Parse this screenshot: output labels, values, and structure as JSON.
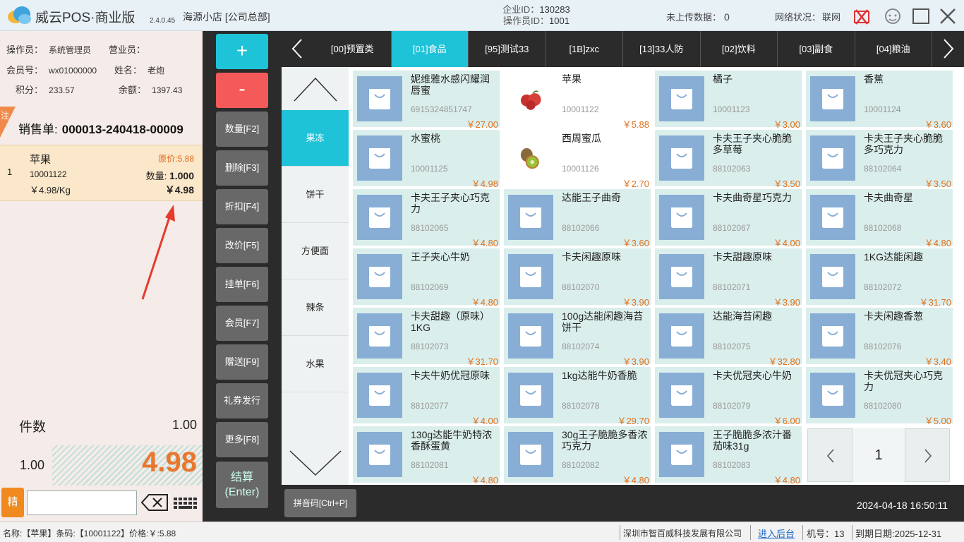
{
  "header": {
    "app_title": "威云POS·商业版",
    "version": "2.4.0.45",
    "store": "海源小店 [公司总部]",
    "enterprise_label": "企业ID：",
    "enterprise_id": "130283",
    "operator_id_label": "操作员ID：",
    "operator_id": "1001",
    "upload_label": "未上传数据：",
    "upload_count": "0",
    "network_label": "网络状况：",
    "network_status": "联网",
    "colors": {
      "accent": "#1ec3d8",
      "minus": "#f45a5a",
      "price": "#e0731e"
    }
  },
  "left": {
    "operator_label": "操作员：",
    "operator": "系统管理员",
    "sales_label": "营业员：",
    "sales": "",
    "member_label": "会员号：",
    "member": "wx01000000",
    "name_label": "姓名：",
    "name": "老炮",
    "points_label": "积分：",
    "points": "233.57",
    "balance_label": "余额：",
    "balance": "1397.43",
    "note_tag": "注",
    "order_label": "销售单:",
    "order_no": "000013-240418-00009",
    "items": [
      {
        "idx": "1",
        "name": "苹果",
        "orig_price": "原价:5.88",
        "code": "10001122",
        "qty_label": "数量:",
        "qty": "1.000",
        "unit_price": "￥4.98/Kg",
        "amount": "￥4.98"
      }
    ],
    "count_label": "件数",
    "count_value": "1.00",
    "sum_qty": "1.00",
    "sum_total": "4.98",
    "precise_label": "精",
    "search_value": ""
  },
  "functions": [
    {
      "name": "add-button",
      "label": "+"
    },
    {
      "name": "subtract-button",
      "label": "-"
    },
    {
      "name": "quantity-button",
      "label": "数量[F2]"
    },
    {
      "name": "delete-button",
      "label": "删除[F3]"
    },
    {
      "name": "discount-button",
      "label": "折扣[F4]"
    },
    {
      "name": "change-price-button",
      "label": "改价[F5]"
    },
    {
      "name": "hold-order-button",
      "label": "挂单[F6]"
    },
    {
      "name": "member-button",
      "label": "会员[F7]"
    },
    {
      "name": "gift-button",
      "label": "赠送[F9]"
    },
    {
      "name": "voucher-button",
      "label": "礼券发行"
    },
    {
      "name": "more-button",
      "label": "更多[F8]"
    }
  ],
  "checkout": {
    "line1": "结算",
    "line2": "(Enter)"
  },
  "tabs": [
    "[00]预置类",
    "[01]食品",
    "[95]测试33",
    "[1B]zxc",
    "[13]33人防",
    "[02]饮料",
    "[03]副食",
    "[04]粮油"
  ],
  "active_tab": 1,
  "subcategories": [
    "果冻",
    "饼干",
    "方便面",
    "辣条",
    "水果"
  ],
  "active_subcategory": 0,
  "products": [
    {
      "name": "妮维雅水感闪耀润唇蜜",
      "code": "6915324851747",
      "price": "￥27.00"
    },
    {
      "name": "苹果",
      "code": "10001122",
      "price": "￥5.88",
      "photo": "apple"
    },
    {
      "name": "橘子",
      "code": "10001123",
      "price": "￥3.00"
    },
    {
      "name": "香蕉",
      "code": "10001124",
      "price": "￥3.60"
    },
    {
      "name": "水蜜桃",
      "code": "10001125",
      "price": "￥4.98"
    },
    {
      "name": "西周蜜瓜",
      "code": "10001126",
      "price": "￥2.70",
      "photo": "kiwi"
    },
    {
      "name": "卡夫王子夹心脆脆多草莓",
      "code": "88102063",
      "price": "￥3.50"
    },
    {
      "name": "卡夫王子夹心脆脆多巧克力",
      "code": "88102064",
      "price": "￥3.50"
    },
    {
      "name": "卡夫王子夹心巧克力",
      "code": "88102065",
      "price": "￥4.80"
    },
    {
      "name": "达能王子曲奇",
      "code": "88102066",
      "price": "￥3.60"
    },
    {
      "name": "卡夫曲奇星巧克力",
      "code": "88102067",
      "price": "￥4.00"
    },
    {
      "name": "卡夫曲奇星",
      "code": "88102068",
      "price": "￥4.80"
    },
    {
      "name": "王子夹心牛奶",
      "code": "88102069",
      "price": "￥4.80"
    },
    {
      "name": "卡夫闲趣原味",
      "code": "88102070",
      "price": "￥3.90"
    },
    {
      "name": "卡夫甜趣原味",
      "code": "88102071",
      "price": "￥3.90"
    },
    {
      "name": "1KG达能闲趣",
      "code": "88102072",
      "price": "￥31.70"
    },
    {
      "name": "卡夫甜趣（原味）1KG",
      "code": "88102073",
      "price": "￥31.70"
    },
    {
      "name": "100g达能闲趣海苔饼干",
      "code": "88102074",
      "price": "￥3.90"
    },
    {
      "name": "达能海苔闲趣",
      "code": "88102075",
      "price": "￥32.80"
    },
    {
      "name": "卡夫闲趣香葱",
      "code": "88102076",
      "price": "￥3.40"
    },
    {
      "name": "卡夫牛奶优冠原味",
      "code": "88102077",
      "price": "￥4.00"
    },
    {
      "name": "1kg达能牛奶香脆",
      "code": "88102078",
      "price": "￥29.70"
    },
    {
      "name": "卡夫优冠夹心牛奶",
      "code": "88102079",
      "price": "￥6.00"
    },
    {
      "name": "卡夫优冠夹心巧克力",
      "code": "88102080",
      "price": "￥5.00"
    },
    {
      "name": "130g达能牛奶特浓香酥蛋黄",
      "code": "88102081",
      "price": "￥4.80"
    },
    {
      "name": "30g王子脆脆多香浓巧克力",
      "code": "88102082",
      "price": "￥4.80"
    },
    {
      "name": "王子脆脆多浓汁番茄味31g",
      "code": "88102083",
      "price": "￥4.80"
    }
  ],
  "pager": {
    "page": "1"
  },
  "bottom": {
    "pinyin_label": "拼音码[Ctrl+P]",
    "datetime": "2024-04-18 16:50:11"
  },
  "status": {
    "product_info": "名称:【苹果】条码:【10001122】价格:￥:5.88",
    "company": "深圳市智百威科技发展有限公司",
    "backend_link": "进入后台",
    "machine": "机号：13",
    "expiry": "到期日期:2025-12-31"
  }
}
